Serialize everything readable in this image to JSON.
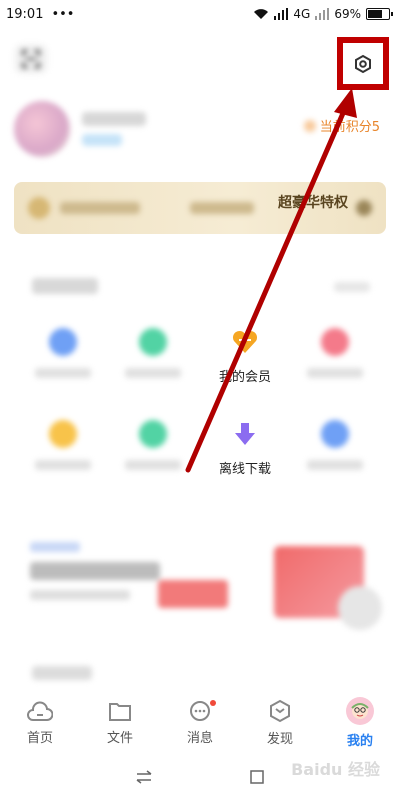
{
  "status_bar": {
    "time": "19:01",
    "dots": "•••",
    "network": "4G",
    "battery": "69%",
    "battery_level": 0.69
  },
  "header": {
    "scan_icon": "scan-icon",
    "settings_icon": "settings-hexagon-icon"
  },
  "profile": {
    "points_text": "当前积分5"
  },
  "vip_banner": {
    "right_text": "超豪华特权"
  },
  "grid_items": [
    {
      "label": "我的会员",
      "icon_color": "#f5a623"
    },
    {
      "label": "离线下载",
      "icon_color": "#8b6cf0"
    }
  ],
  "bottom_nav": {
    "items": [
      {
        "label": "首页",
        "icon": "cloud-icon"
      },
      {
        "label": "文件",
        "icon": "folder-icon"
      },
      {
        "label": "消息",
        "icon": "message-icon"
      },
      {
        "label": "发现",
        "icon": "discover-icon"
      },
      {
        "label": "我的",
        "icon": "avatar-icon"
      }
    ],
    "active_index": 4,
    "accent": "#2980f0"
  },
  "watermark": "Baidu 经验",
  "annotation": {
    "color": "#b00000"
  }
}
